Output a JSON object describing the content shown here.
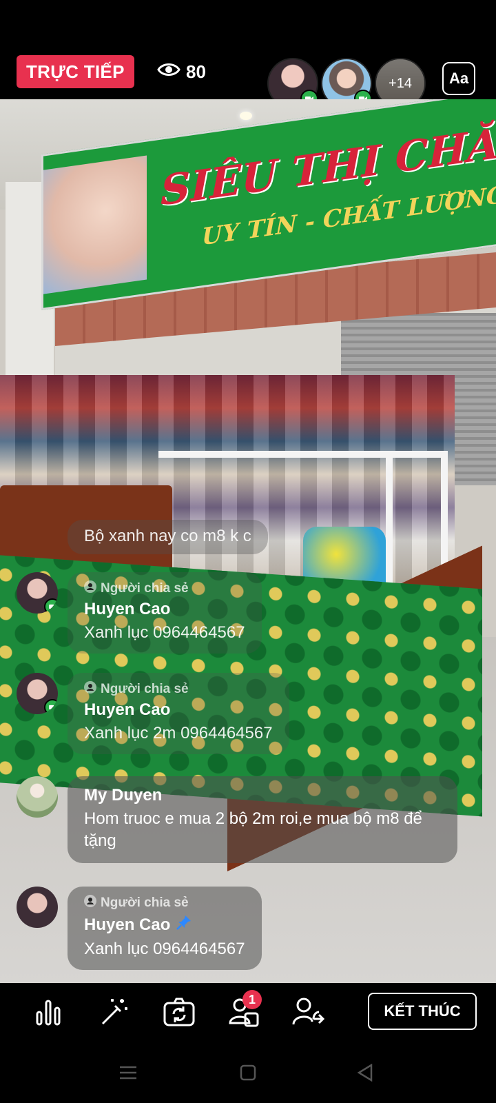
{
  "status": {
    "live_label": "TRỰC TIẾP",
    "viewer_count": "80",
    "extra_participants": "+14",
    "text_button_label": "Aa"
  },
  "scene": {
    "banner_title": "SIÊU THỊ CHĂN - GA - GÔ",
    "banner_subtitle": "UY TÍN - CHẤT LƯỢNG - HẢ"
  },
  "comments": [
    {
      "text": "Bộ xanh nay co m8 k c"
    },
    {
      "sharer_label": "Người chia sẻ",
      "name": "Huyen Cao",
      "text": "Xanh lục   0964464567"
    },
    {
      "sharer_label": "Người chia sẻ",
      "name": "Huyen Cao",
      "text": "Xanh lục 2m 0964464567"
    },
    {
      "name": "My Duyen",
      "text": "Hom truoc e mua 2 bộ 2m roi,e mua bộ m8 để tặng"
    },
    {
      "sharer_label": "Người chia sẻ",
      "name": "Huyen Cao",
      "text": "Xanh lục   0964464567",
      "pinned": true
    }
  ],
  "toolbar": {
    "guests_badge": "1",
    "end_button_label": "KẾT THÚC"
  },
  "colors": {
    "live_red": "#e8314f",
    "camera_green": "#2bb24c",
    "pin_blue": "#2d88ff"
  },
  "icons": [
    "eye-icon",
    "camera-icon",
    "poll-icon",
    "effects-wand-icon",
    "switch-camera-icon",
    "guests-icon",
    "share-person-icon",
    "pin-icon",
    "menu-icon",
    "home-icon",
    "back-icon"
  ]
}
